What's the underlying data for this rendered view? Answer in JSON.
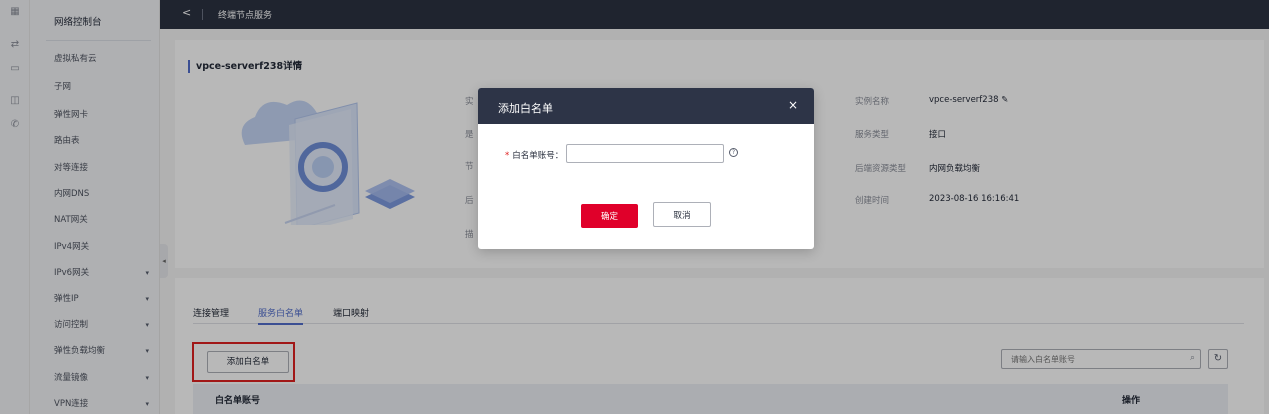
{
  "rail": {
    "icons": [
      "grid-icon",
      "network-icon",
      "monitor-icon",
      "window-icon",
      "phone-icon"
    ]
  },
  "sidebar": {
    "title": "网络控制台",
    "items": [
      {
        "label": "虚拟私有云",
        "expandable": false
      },
      {
        "label": "子网",
        "expandable": false
      },
      {
        "label": "弹性网卡",
        "expandable": false
      },
      {
        "label": "路由表",
        "expandable": false
      },
      {
        "label": "对等连接",
        "expandable": false
      },
      {
        "label": "内网DNS",
        "expandable": false
      },
      {
        "label": "NAT网关",
        "expandable": false
      },
      {
        "label": "IPv4网关",
        "expandable": false
      },
      {
        "label": "IPv6网关",
        "expandable": true
      },
      {
        "label": "弹性IP",
        "expandable": true
      },
      {
        "label": "访问控制",
        "expandable": true
      },
      {
        "label": "弹性负载均衡",
        "expandable": true
      },
      {
        "label": "流量镜像",
        "expandable": true
      },
      {
        "label": "VPN连接",
        "expandable": true
      }
    ],
    "chevron": "▾",
    "collapse": "◂"
  },
  "topbar": {
    "back": "<",
    "title": "终端节点服务"
  },
  "detail": {
    "heading": "vpce-serverf238详情",
    "left_labels": [
      "实",
      "是",
      "节",
      "后",
      "描"
    ],
    "right": [
      {
        "label": "实例名称",
        "value": "vpce-serverf238 ✎"
      },
      {
        "label": "服务类型",
        "value": "接口"
      },
      {
        "label": "后端资源类型",
        "value": "内网负载均衡"
      },
      {
        "label": "创建时间",
        "value": "2023-08-16 16:16:41"
      }
    ]
  },
  "tabs": [
    {
      "label": "连接管理",
      "active": false
    },
    {
      "label": "服务白名单",
      "active": true
    },
    {
      "label": "端口映射",
      "active": false
    }
  ],
  "whitelist": {
    "add_button": "添加白名单",
    "search_placeholder": "请输入白名单账号",
    "search_icon": "⌕",
    "refresh_icon": "↻",
    "columns": [
      "白名单账号",
      "操作"
    ]
  },
  "dialog": {
    "title": "添加白名单",
    "close": "×",
    "field_required": "*",
    "field_label": "白名单账号：",
    "field_value": "",
    "help": "?",
    "ok": "确定",
    "cancel": "取消"
  },
  "colors": {
    "topbar": "#2b3242",
    "accent": "#526ecc",
    "primary_button": "#e0002a",
    "highlight_box": "#e02020"
  }
}
